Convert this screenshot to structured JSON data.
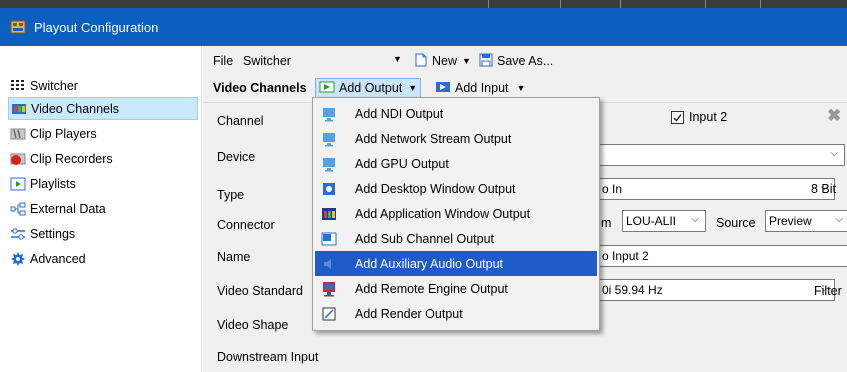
{
  "window": {
    "title": "Playout Configuration"
  },
  "sidebar": {
    "items": [
      {
        "label": "Switcher",
        "icon": "switcher-grid-icon"
      },
      {
        "label": "Video Channels",
        "icon": "video-channels-icon",
        "selected": true
      },
      {
        "label": "Clip Players",
        "icon": "clip-players-icon"
      },
      {
        "label": "Clip Recorders",
        "icon": "clip-recorders-icon"
      },
      {
        "label": "Playlists",
        "icon": "playlists-icon"
      },
      {
        "label": "External Data",
        "icon": "external-data-icon"
      },
      {
        "label": "Settings",
        "icon": "settings-icon"
      },
      {
        "label": "Advanced",
        "icon": "advanced-icon"
      }
    ]
  },
  "file_bar": {
    "label": "File",
    "value": "Switcher",
    "new_label": "New",
    "save_as_label": "Save As..."
  },
  "toolbar": {
    "section_label": "Video Channels",
    "add_output_label": "Add Output",
    "add_input_label": "Add Input"
  },
  "form": {
    "labels": [
      "Channel",
      "Device",
      "Type",
      "Connector",
      "Name",
      "Video Standard",
      "Video Shape",
      "Downstream Input"
    ],
    "input2_checkbox": {
      "label": "Input 2",
      "checked": true
    },
    "type_value": "o In",
    "bit_depth": "8 Bit",
    "connector_prefix": "m",
    "connector_value": "LOU-ALII",
    "source_label": "Source",
    "source_value": "Preview",
    "name_value": "o Input 2",
    "video_standard_value": "0i 59.94 Hz",
    "filter_label": "Filter"
  },
  "menu": {
    "items": [
      {
        "label": "Add NDI Output",
        "icon": "ndi-output-icon"
      },
      {
        "label": "Add Network Stream Output",
        "icon": "network-stream-icon"
      },
      {
        "label": "Add GPU Output",
        "icon": "gpu-output-icon"
      },
      {
        "label": "Add Desktop Window Output",
        "icon": "desktop-window-icon"
      },
      {
        "label": "Add Application Window Output",
        "icon": "application-window-icon"
      },
      {
        "label": "Add Sub Channel Output",
        "icon": "sub-channel-icon"
      },
      {
        "label": "Add Auxiliary Audio Output",
        "icon": "auxiliary-audio-icon",
        "highlighted": true
      },
      {
        "label": "Add Remote Engine Output",
        "icon": "remote-engine-icon"
      },
      {
        "label": "Add Render Output",
        "icon": "render-output-icon"
      }
    ]
  },
  "colors": {
    "titlebar": "#0a5fbf",
    "selection": "#cce8ff",
    "menu_highlight": "#1f5cc7",
    "panel": "#f0f0f0"
  }
}
